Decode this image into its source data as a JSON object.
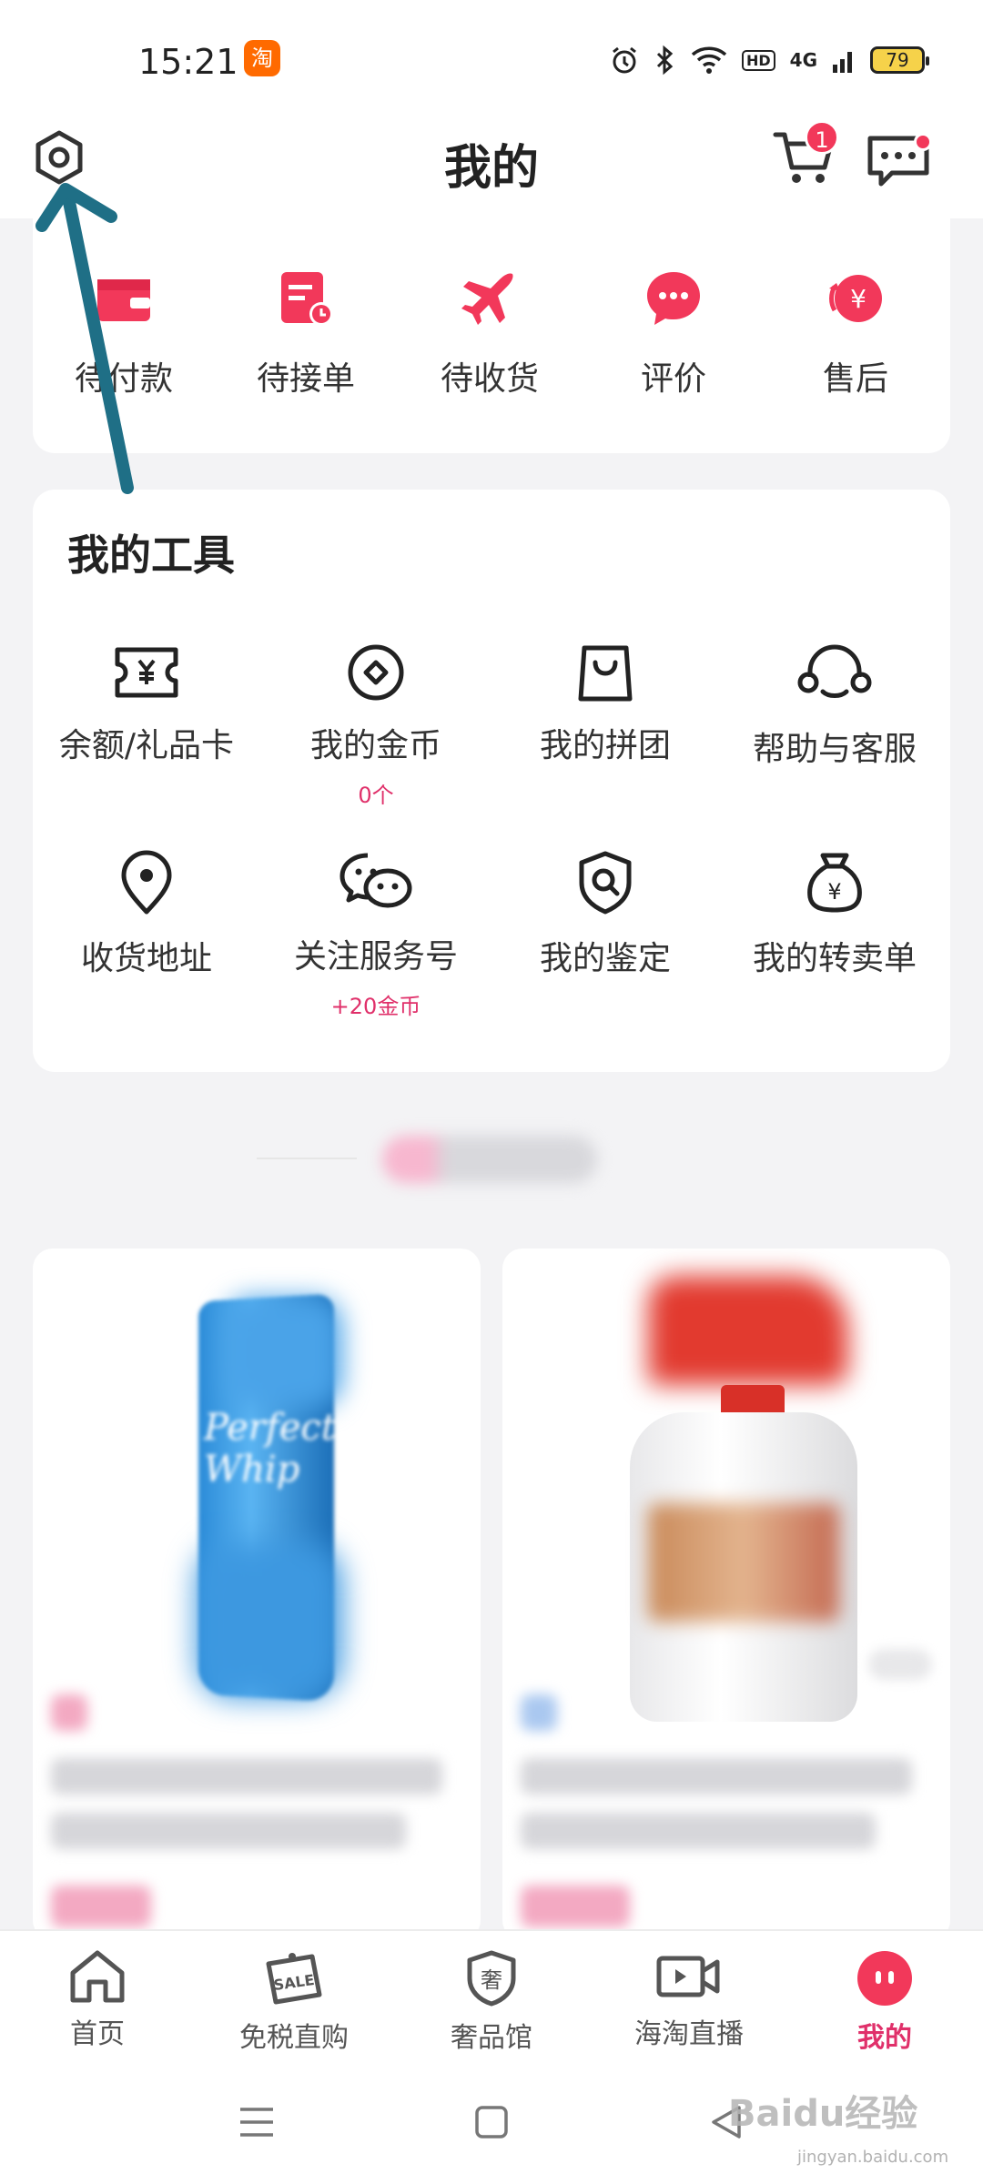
{
  "status_bar": {
    "time": "15:21",
    "app_icon": "淘",
    "hd": "HD",
    "network": "4G",
    "battery": "79"
  },
  "header": {
    "title": "我的",
    "cart_badge": "1"
  },
  "orders": [
    {
      "label": "待付款",
      "icon": "wallet-icon"
    },
    {
      "label": "待接单",
      "icon": "order-clock-icon"
    },
    {
      "label": "待收货",
      "icon": "airplane-icon"
    },
    {
      "label": "评价",
      "icon": "comment-icon"
    },
    {
      "label": "售后",
      "icon": "after-sale-icon"
    }
  ],
  "tools": {
    "title": "我的工具",
    "items": [
      {
        "label": "余额/礼品卡",
        "sub": "",
        "icon": "ticket-icon"
      },
      {
        "label": "我的金币",
        "sub": "0个",
        "icon": "coin-icon"
      },
      {
        "label": "我的拼团",
        "sub": "",
        "icon": "bag-icon"
      },
      {
        "label": "帮助与客服",
        "sub": "",
        "icon": "headset-icon"
      },
      {
        "label": "收货地址",
        "sub": "",
        "icon": "location-icon"
      },
      {
        "label": "关注服务号",
        "sub": "+20金币",
        "icon": "wechat-icon"
      },
      {
        "label": "我的鉴定",
        "sub": "",
        "icon": "shield-search-icon"
      },
      {
        "label": "我的转卖单",
        "sub": "",
        "icon": "money-bag-icon"
      }
    ]
  },
  "products": {
    "left_brand_text": "Perfect Whip"
  },
  "tabbar": [
    {
      "label": "首页",
      "icon": "home-icon",
      "active": false
    },
    {
      "label": "免税直购",
      "icon": "sale-tag-icon",
      "active": false
    },
    {
      "label": "奢品馆",
      "icon": "luxury-shield-icon",
      "active": false
    },
    {
      "label": "海淘直播",
      "icon": "live-video-icon",
      "active": false
    },
    {
      "label": "我的",
      "icon": "profile-icon",
      "active": true
    }
  ],
  "tabbar_glyphs": {
    "sale": "SALE",
    "luxury": "奢"
  },
  "watermark": {
    "brand": "Baidu经验",
    "url": "jingyan.baidu.com"
  },
  "colors": {
    "accent": "#f2385a",
    "active_tab": "#e0306a",
    "arrow": "#1f6f86"
  }
}
